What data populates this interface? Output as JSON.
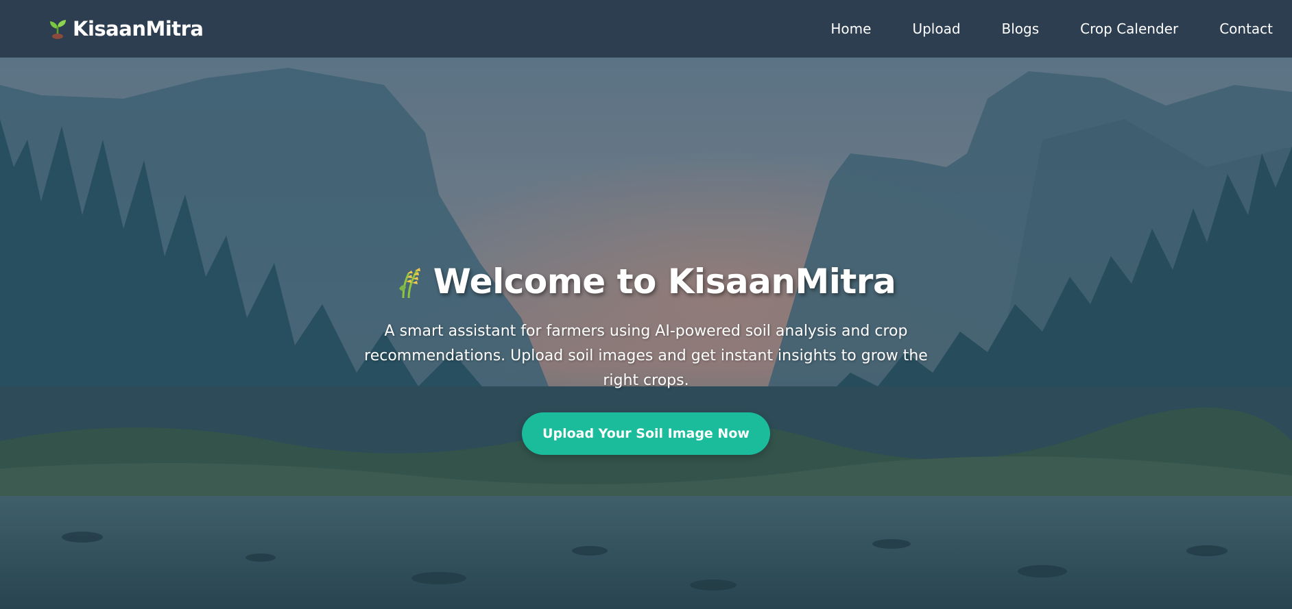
{
  "brand": {
    "name": "KisaanMitra",
    "icon": "seedling-icon"
  },
  "nav": {
    "items": [
      {
        "label": "Home"
      },
      {
        "label": "Upload"
      },
      {
        "label": "Blogs"
      },
      {
        "label": "Crop Calender"
      },
      {
        "label": "Contact"
      }
    ]
  },
  "hero": {
    "title_icon": "wheat-icon",
    "title": "Welcome to KisaanMitra",
    "subtitle": "A smart assistant for farmers using AI-powered soil analysis and crop recommendations. Upload soil images and get instant insights to grow the right crops.",
    "cta_label": "Upload Your Soil Image Now",
    "background": "misty-mountain-forest-river-photo"
  },
  "colors": {
    "navbar": "#2c3e50",
    "accent": "#1abc9c",
    "text": "#ffffff"
  }
}
